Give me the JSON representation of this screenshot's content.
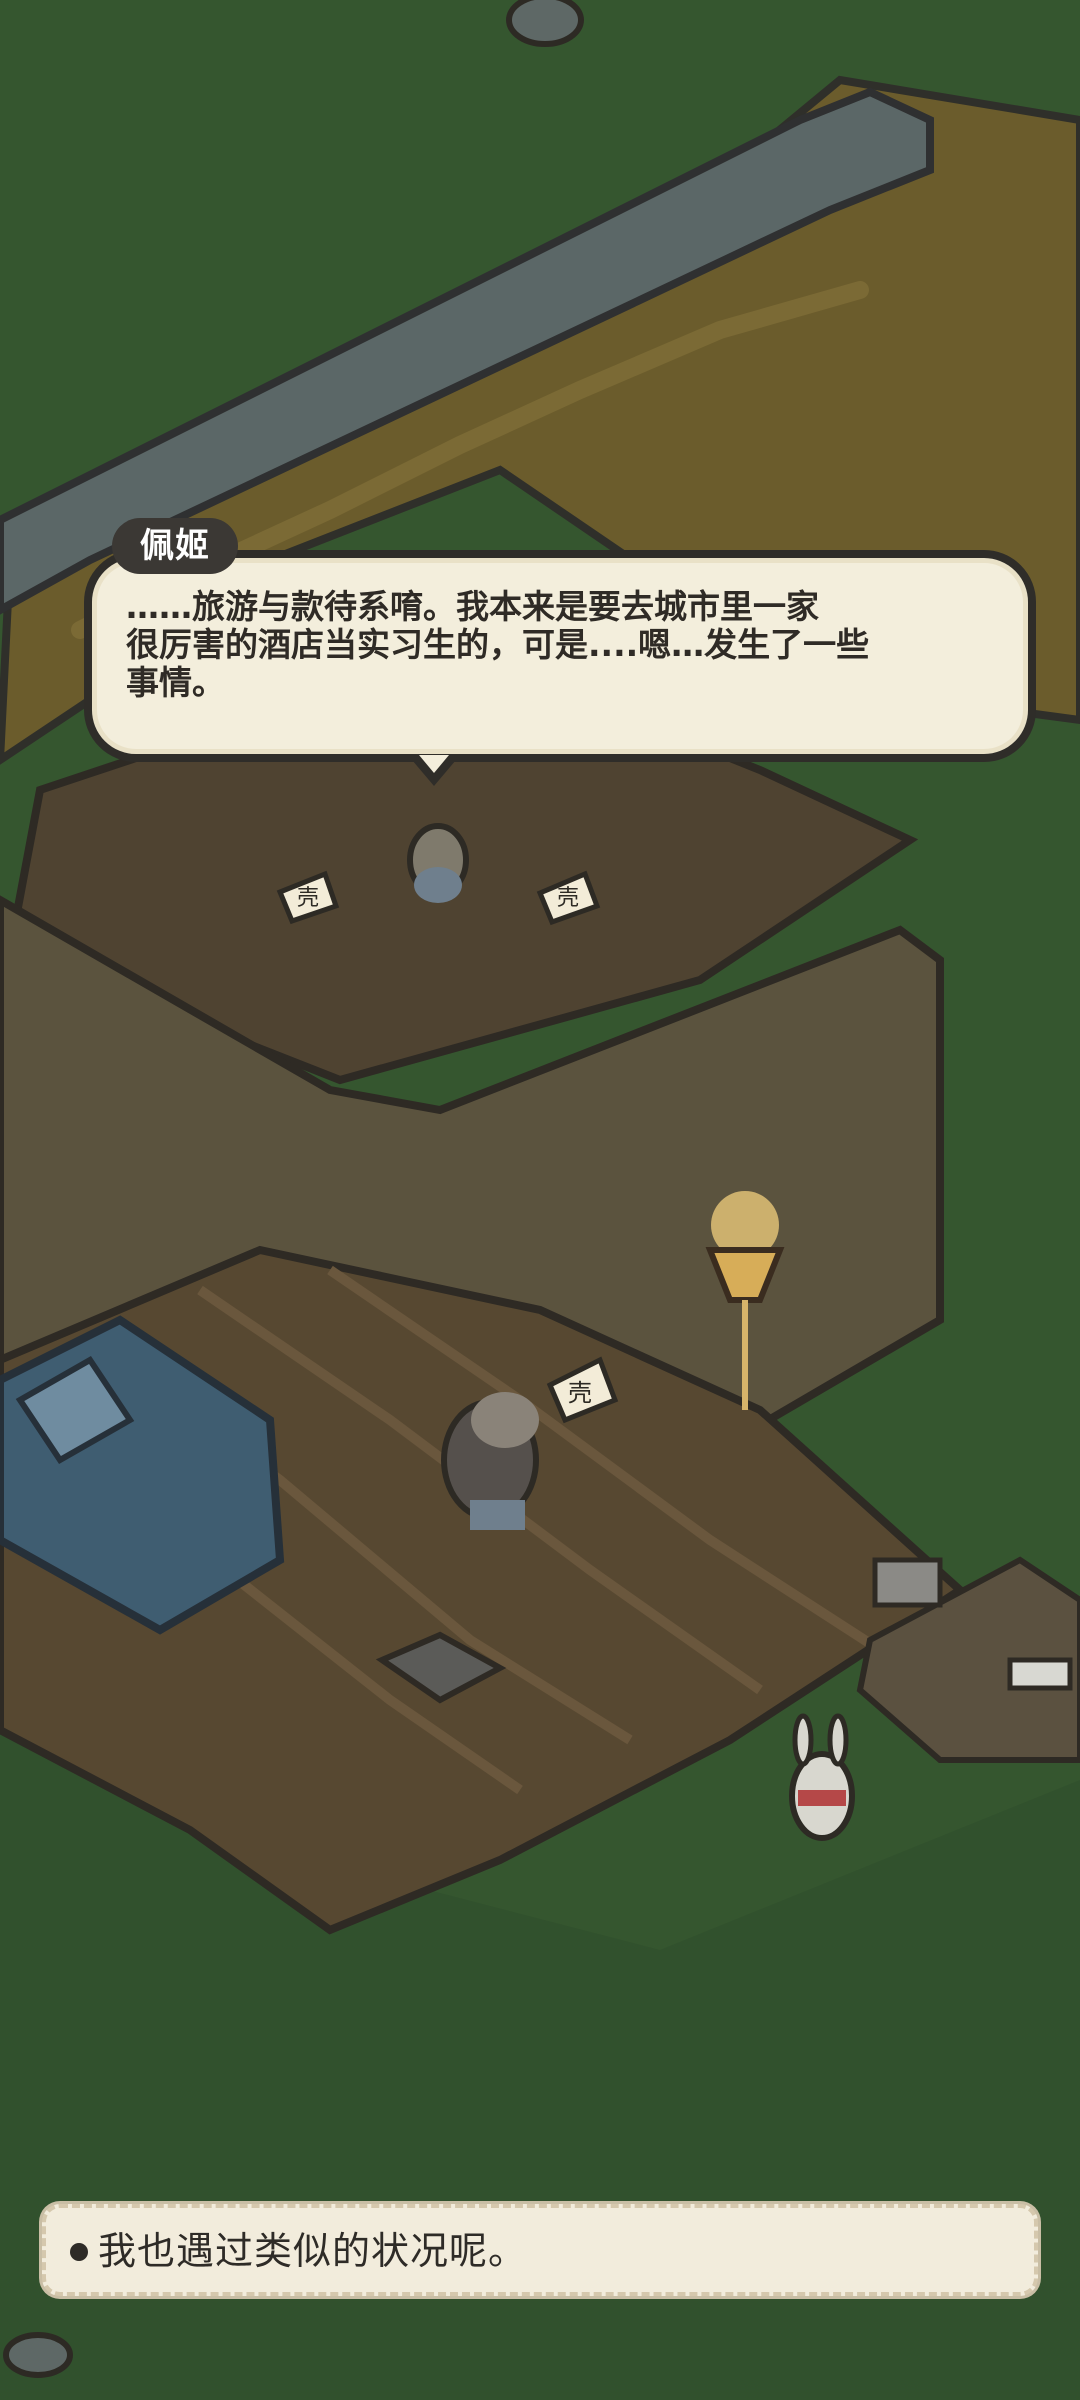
{
  "dialogue": {
    "speaker": "佩姬",
    "text": "……旅游与款待系唷。我本来是要去城市里一家\n很厉害的酒店当实习生的，可是....嗯…发生了一些\n事情。"
  },
  "choices": [
    {
      "label": "我也遇过类似的状况呢。"
    }
  ],
  "sign": {
    "glyph": "壳"
  },
  "colors": {
    "grass": "#35562f",
    "roof": "#6b5c2c",
    "floor": "#4f4331",
    "wall": "#5b533e",
    "bed": "#3f5d71",
    "bubble": "#f3eedc",
    "accent": "#e6c773"
  }
}
